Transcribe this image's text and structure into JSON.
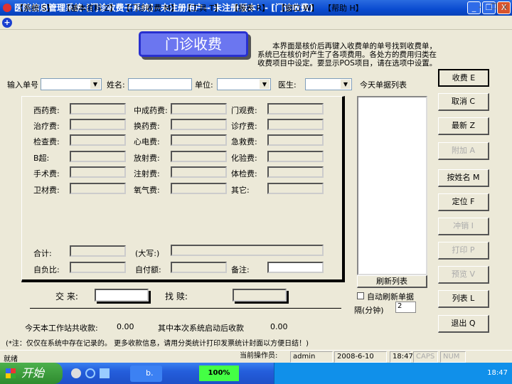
{
  "window": {
    "title": "医院信息管理系统-[门诊收费子系统]--未注册用户-- 未注册版本！- [门诊收费]",
    "min": "_",
    "restore": "❐",
    "close": "X"
  },
  "menu": [
    "【系统 S】",
    "【基本资料 Z】",
    "【门诊收费 M】",
    "【工具 T】",
    "【报表 R】",
    "【窗口 W】",
    "【帮助 H】"
  ],
  "mdi_controls": [
    "-",
    "❐",
    "x"
  ],
  "banner": "门诊收费",
  "description": "本界面是核价后再键入收费单的单号找到收费单，系统已在核价时产生了各项费用。各处方的费用归类在收费项目中设定。要显示POS项目，请在选项中设置。",
  "inputs": {
    "bill_no_label": "输入单号",
    "name_label": "姓名:",
    "unit_label": "单位:",
    "doctor_label": "医生:",
    "today_list_label": "今天单据列表"
  },
  "fees": [
    [
      "西药费:",
      "中成药费:",
      "门观费:"
    ],
    [
      "治疗费:",
      "换药费:",
      "诊疗费:"
    ],
    [
      "检查费:",
      "心电费:",
      "急救费:"
    ],
    [
      "B超:",
      "放射费:",
      "化验费:"
    ],
    [
      "手术费:",
      "注射费:",
      "体检费:"
    ],
    [
      "卫材费:",
      "氧气费:",
      "其它:"
    ]
  ],
  "totals": {
    "total": "合计:",
    "capital": "(大写:)",
    "self_ratio": "自负比:",
    "self_pay": "自付额:",
    "remark": "备注:"
  },
  "payment": {
    "received": "交 来:",
    "change": "找 赎:"
  },
  "refresh_list": "刷新列表",
  "auto_refresh": "自动刷新单据",
  "interval_label": "隔(分钟)",
  "interval_value": "2",
  "buttons": [
    {
      "label": "收费 E",
      "enabled": true
    },
    {
      "label": "取消 C",
      "enabled": true
    },
    {
      "label": "最新 Z",
      "enabled": true
    },
    {
      "label": "附加 A",
      "enabled": false
    },
    {
      "label": "按姓名 M",
      "enabled": true
    },
    {
      "label": "定位 F",
      "enabled": true
    },
    {
      "label": "冲销 I",
      "enabled": false
    },
    {
      "label": "打印 P",
      "enabled": false
    },
    {
      "label": "预览 V",
      "enabled": false
    },
    {
      "label": "列表 L",
      "enabled": true
    },
    {
      "label": "退出 Q",
      "enabled": true
    }
  ],
  "summary": {
    "today_label": "今天本工作站共收款:",
    "today_value": "0.00",
    "since_label": "其中本次系统启动后收款",
    "since_value": "0.00"
  },
  "note": "(*注：仅仅在系统中存在记录的。 更多收款信息，请用分类统计打印发票统计封面以方便日结！)",
  "statusbar": {
    "ready": "就绪",
    "operator_label": "当前操作员:",
    "operator": "admin",
    "date": "2008-6-10",
    "time": "18:47",
    "caps": "CAPS",
    "num": "NUM"
  },
  "taskbar": {
    "start": "开始",
    "task": "b.",
    "zoom": "100%",
    "clock": "18:47"
  }
}
